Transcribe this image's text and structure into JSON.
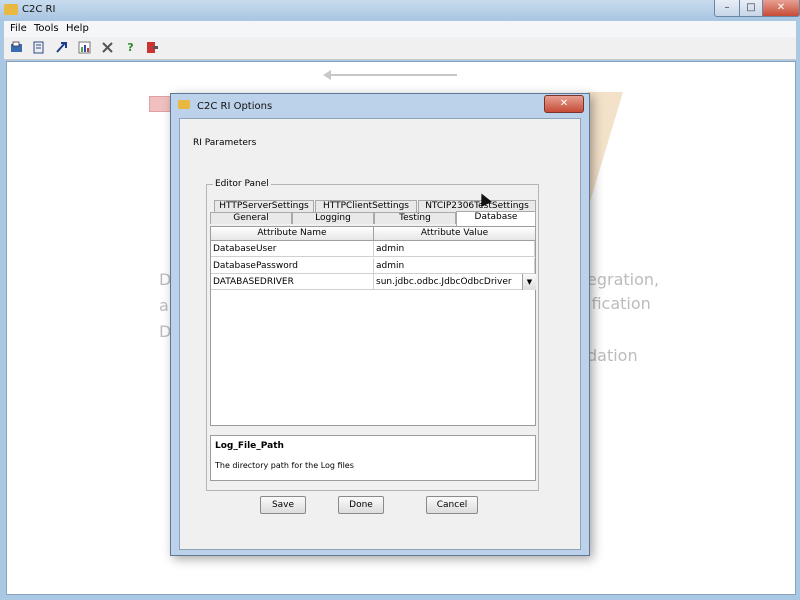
{
  "window": {
    "title": "C2C RI",
    "min": "–",
    "max": "□",
    "close": "✕"
  },
  "menu": [
    "File",
    "Tools",
    "Help"
  ],
  "toolbar_icons": [
    "open-icon",
    "save-icon",
    "run-icon",
    "report-icon",
    "tools-icon",
    "help-icon",
    "exit-icon"
  ],
  "background": {
    "fragments": [
      "D",
      "a",
      "D",
      "egration,",
      "ification",
      "dation"
    ]
  },
  "dialog": {
    "title": "C2C RI Options",
    "close": "✕",
    "section_label": "RI Parameters",
    "editor_panel_label": "Editor Panel",
    "tabs_row1": [
      "HTTPServerSettings",
      "HTTPClientSettings",
      "NTCIP2306TestSettings"
    ],
    "tabs_row2": [
      "General",
      "Logging",
      "Testing",
      "Database"
    ],
    "active_tab": "Database",
    "table": {
      "headers": [
        "Attribute Name",
        "Attribute Value"
      ],
      "rows": [
        [
          "DatabaseUser",
          "admin"
        ],
        [
          "DatabasePassword",
          "admin"
        ],
        [
          "DATABASEDRIVER",
          "sun.jdbc.odbc.JdbcOdbcDriver"
        ]
      ]
    },
    "info": {
      "title": "Log_File_Path",
      "description": "The directory path for the Log files"
    },
    "buttons": {
      "save": "Save",
      "done": "Done",
      "cancel": "Cancel"
    }
  }
}
